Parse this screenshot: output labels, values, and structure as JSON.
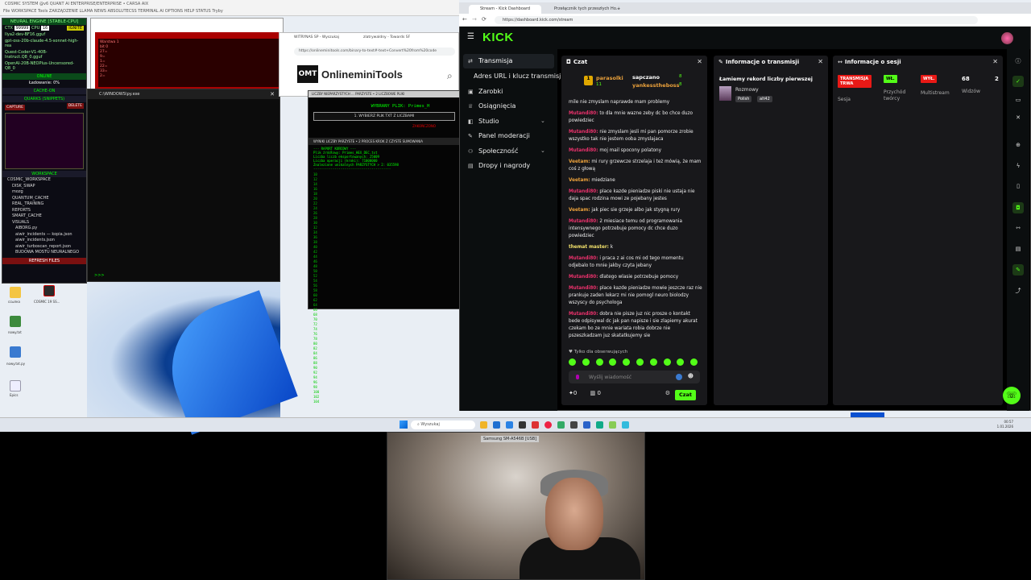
{
  "desktop_top": {
    "title": "COSMIC SYSTEM @v6 QUANT AI ENTERPRISE/ENTERPRISE • CARSA AIX",
    "menu": "File  WORKSPACE  Tools  ZARZĄDZENIE  LLAMA  NEWS  ABSOLUTECSS  TERMINAL AI  OPTIONS  HELP  STATUS  Tryby"
  },
  "neural_panel": {
    "header": "NEURAL ENGINE [STABLE-CPU]",
    "ctx_label": "CTX",
    "ctx_value": "99999",
    "cpu_label": "CPU",
    "cpu_value": "16",
    "ignite": "IGNITE",
    "models": [
      "Ilya2-dev-BF16.gguf",
      "gpt-oss-20b-claude-4.5-sonnet-high-rea",
      "Quest-Coder-V1-40B-Instruct.Q8_0.gguf",
      "OpenAI-20B-NEOPlus-Uncensored-Q8_0"
    ],
    "status": "ONLINE",
    "loading": "Ładowanie: 0%",
    "cache": "CACHE-ON",
    "quarks": "QUARKS (SNIPPETS)",
    "capture": "CAPTURE",
    "delete": "DELETE",
    "workspace": "WORKSPACE",
    "tree": [
      "COSMIC_WORKSPACE",
      "DISK_SWAP",
      "mozg",
      "QUANTUM_CACHE",
      "REAL_TRAINING",
      "REPORTS",
      "SMART_CACHE",
      "VISUALS",
      "AIBORG.py",
      "aiwir_incidents — kopia.json",
      "aiwir_incidents.json",
      "aiwir_turboscan_report.json",
      "BUDOWA MOSTU NEURALNEGO"
    ],
    "refresh": "REFRESH FILES"
  },
  "red_window": {
    "heading": "Warstwa 1",
    "lines": [
      "bit 0",
      "27=",
      "9=",
      "1=",
      "22=",
      "33=",
      "2=",
      "32=K"
    ]
  },
  "cmd": {
    "title": "C:\\WINDOWS\\py.exe",
    "prompt": ">>>"
  },
  "omt": {
    "tabs": [
      "WITRYNAS SP - Wyszukaj",
      "zlatrywaldny - Towards SF"
    ],
    "url": "https://onlineminitools.com/binary-to-text#-text+Convert%20from%20code",
    "logo": "OMT",
    "name": "OnlineminiTools"
  },
  "analyzer": {
    "header": "LICZBY NIEPARZYSTYCH ... PARZYSTE • 2 LICZBOWE PLIKI",
    "title": "WYBRANY PLIK: Primes_H",
    "button": "1. WYBIERZ PLIK TXT Z LICZBAMI",
    "done": "ZAKOŃCZONO",
    "tabs": "WYNIKI LICZBY PARZYSTE • 2    PROCES KROK Z CZYSTE SUMOWANIA",
    "report": "--- RAPORT KOŃCOWY ---\nPlik źródłowy: Primes_HEX_DEC.txt\nLiczba liczb eksportowanych: 25009\nLiczba operacji (kroki): 71000000\nZnalezione unikalnych PARZYSTYCH > 2: 035598\n----------------------------------------",
    "numbers": [
      "10",
      "12",
      "14",
      "16",
      "18",
      "20",
      "22",
      "24",
      "26",
      "28",
      "30",
      "32",
      "34",
      "36",
      "38",
      "40",
      "42",
      "44",
      "46",
      "48",
      "50",
      "52",
      "54",
      "56",
      "58",
      "60",
      "62",
      "64",
      "66",
      "68",
      "70",
      "72",
      "74",
      "76",
      "78",
      "80",
      "82",
      "84",
      "86",
      "88",
      "90",
      "92",
      "94",
      "96",
      "98",
      "100",
      "102",
      "104"
    ]
  },
  "desktop_icons": [
    {
      "label": "ссылка"
    },
    {
      "label": "COSMIC 19 SS..."
    },
    {
      "label": "nowy.txt"
    },
    {
      "label": "nowy.txt.py"
    },
    {
      "label": "Epics"
    }
  ],
  "taskbar": {
    "search": "Wyszukaj",
    "time": "00:57",
    "date": "1.01.2026"
  },
  "webcam": {
    "label": "Samsung SM-A546B [USB]"
  },
  "browser": {
    "tabs": [
      "Stream - Kick Dashboard",
      "Przełącznik tych przeszłych Ho..."
    ],
    "url": "https://dashboard.kick.com/stream"
  },
  "kick": {
    "logo": "KICK",
    "nav": [
      {
        "label": "Transmisja",
        "icon": "stream-icon"
      },
      {
        "label": "Adres URL i klucz transmisji",
        "icon": ""
      },
      {
        "label": "Zarobki",
        "icon": "wallet-icon"
      },
      {
        "label": "Osiągnięcia",
        "icon": "trophy-icon"
      },
      {
        "label": "Studio",
        "icon": "studio-icon"
      },
      {
        "label": "Panel moderacji",
        "icon": "wrench-icon"
      },
      {
        "label": "Społeczność",
        "icon": "community-icon"
      },
      {
        "label": "Dropy i nagrody",
        "icon": "gift-icon"
      }
    ],
    "chat": {
      "title": "Czat",
      "leaderboard": [
        {
          "rank": "1",
          "name": "parasolki",
          "count": "11"
        },
        {
          "name": "sapczano",
          "count": "8"
        },
        {
          "name": "yankesstheboss",
          "count": "8"
        }
      ],
      "messages": [
        {
          "user": "",
          "text": "mile nie zmyslam naprawde mam problemy",
          "color": "u-red"
        },
        {
          "user": "Mutandi80:",
          "text": "to dla mnie wazne zeby dc bo chce duzo powiedziec",
          "color": "u-red"
        },
        {
          "user": "Mutandi80:",
          "text": "nie zmyslam jesli mi pan pomorze zrobie wszystko tak nie jestem ooba zmyslajaca",
          "color": "u-red"
        },
        {
          "user": "Mutandi80:",
          "text": "moj mail spocony polatony",
          "color": "u-red"
        },
        {
          "user": "Veetam:",
          "text": "mi rury grzewcze strzelaja i też mówią, że mam coś z głową",
          "color": "u-or"
        },
        {
          "user": "Veetam:",
          "text": "miedziane",
          "color": "u-or"
        },
        {
          "user": "Mutandi80:",
          "text": "place kazde pieniadze piski nie ustaja nie daja spac rodzina mowi ze pojebany jestes",
          "color": "u-red"
        },
        {
          "user": "Veetam:",
          "text": "jak piec sie grzeje albo jak stygną rury",
          "color": "u-or"
        },
        {
          "user": "Mutandi80:",
          "text": "2 miesiace temu od programowania intensywnego potrzebuje pomocy dc chce duzo powiedziec",
          "color": "u-red"
        },
        {
          "user": "themat master:",
          "text": "k",
          "color": "u-ye"
        },
        {
          "user": "Mutandi80:",
          "text": "i praca z ai cos mi od tego momentu odjebalo to mnie jakby czyta jebany",
          "color": "u-red"
        },
        {
          "user": "Mutandi80:",
          "text": "dlatego wlasie potrzebuje pomocy",
          "color": "u-red"
        },
        {
          "user": "Mutandi80:",
          "text": "place kazde pieniadze mowie jeszcze raz nie prankuje zaden lekarz mi nie pomogl neuro biolodzy wszyscy do psychologa",
          "color": "u-red"
        },
        {
          "user": "Mutandi80:",
          "text": "dobra nie pisze juz nic prosze o kontakt bede odpisywal dc jak pan napisze i sie zlapiemy akurat czekam bo ze mnie wariata robia dobrze nie pszeszkadzam juz skatatkujemy sie",
          "color": "u-red"
        }
      ],
      "follow_only": "Tylko dla obserwujących",
      "placeholder": "Wyślij wiadomość",
      "points": "0",
      "gifts": "0",
      "send": "Czat"
    },
    "info": {
      "title": "Informacje o transmisji",
      "stream_title": "Łamiemy rekord liczby pierwszej",
      "category": "Rozmowy",
      "tags": [
        "Polish",
        "alt42"
      ]
    },
    "session": {
      "title": "Informacje o sesji",
      "live_badge": "TRANSMISJA TRWA",
      "session_label": "Sesja",
      "revenue_badge": "WŁ.",
      "revenue_label": "Przychód twórcy",
      "multistream_badge": "WYŁ.",
      "multistream_label": "Multistream",
      "viewers_value": "68",
      "viewers_label": "Widzów",
      "extra_value": "2"
    }
  },
  "colors": {
    "kick_green": "#53fc18",
    "kick_bg": "#0b0e0f",
    "panel_bg": "#18181b",
    "badge_red": "#e91916"
  }
}
